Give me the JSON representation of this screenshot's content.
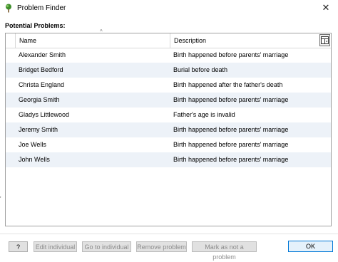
{
  "window": {
    "title": "Problem Finder",
    "close_glyph": "✕",
    "icon": "tree-icon"
  },
  "section_label": "Potential Problems:",
  "grid": {
    "columns": [
      "Name",
      "Description"
    ],
    "sort_glyph": "^",
    "rows": [
      {
        "name": "Alexander Smith",
        "description": "Birth happened before parents' marriage"
      },
      {
        "name": "Bridget Bedford",
        "description": "Burial before death"
      },
      {
        "name": "Christa England",
        "description": "Birth happened after the father's death"
      },
      {
        "name": "Georgia Smith",
        "description": "Birth happened before parents' marriage"
      },
      {
        "name": "Gladys Littlewood",
        "description": "Father's age is invalid"
      },
      {
        "name": "Jeremy Smith",
        "description": "Birth happened before parents' marriage"
      },
      {
        "name": "Joe Wells",
        "description": "Birth happened before parents' marriage"
      },
      {
        "name": "John Wells",
        "description": "Birth happened before parents' marriage"
      }
    ]
  },
  "buttons": {
    "help": "?",
    "edit_individual": "Edit individual",
    "go_to_individual": "Go to individual",
    "remove_problem": "Remove problem",
    "mark_not_problem": "Mark as not a problem",
    "ok": "OK"
  },
  "side_mark": "'",
  "colors": {
    "row_alt": "#edf2f8",
    "ok_border": "#0078d7",
    "disabled_text": "#8b8b8b"
  }
}
